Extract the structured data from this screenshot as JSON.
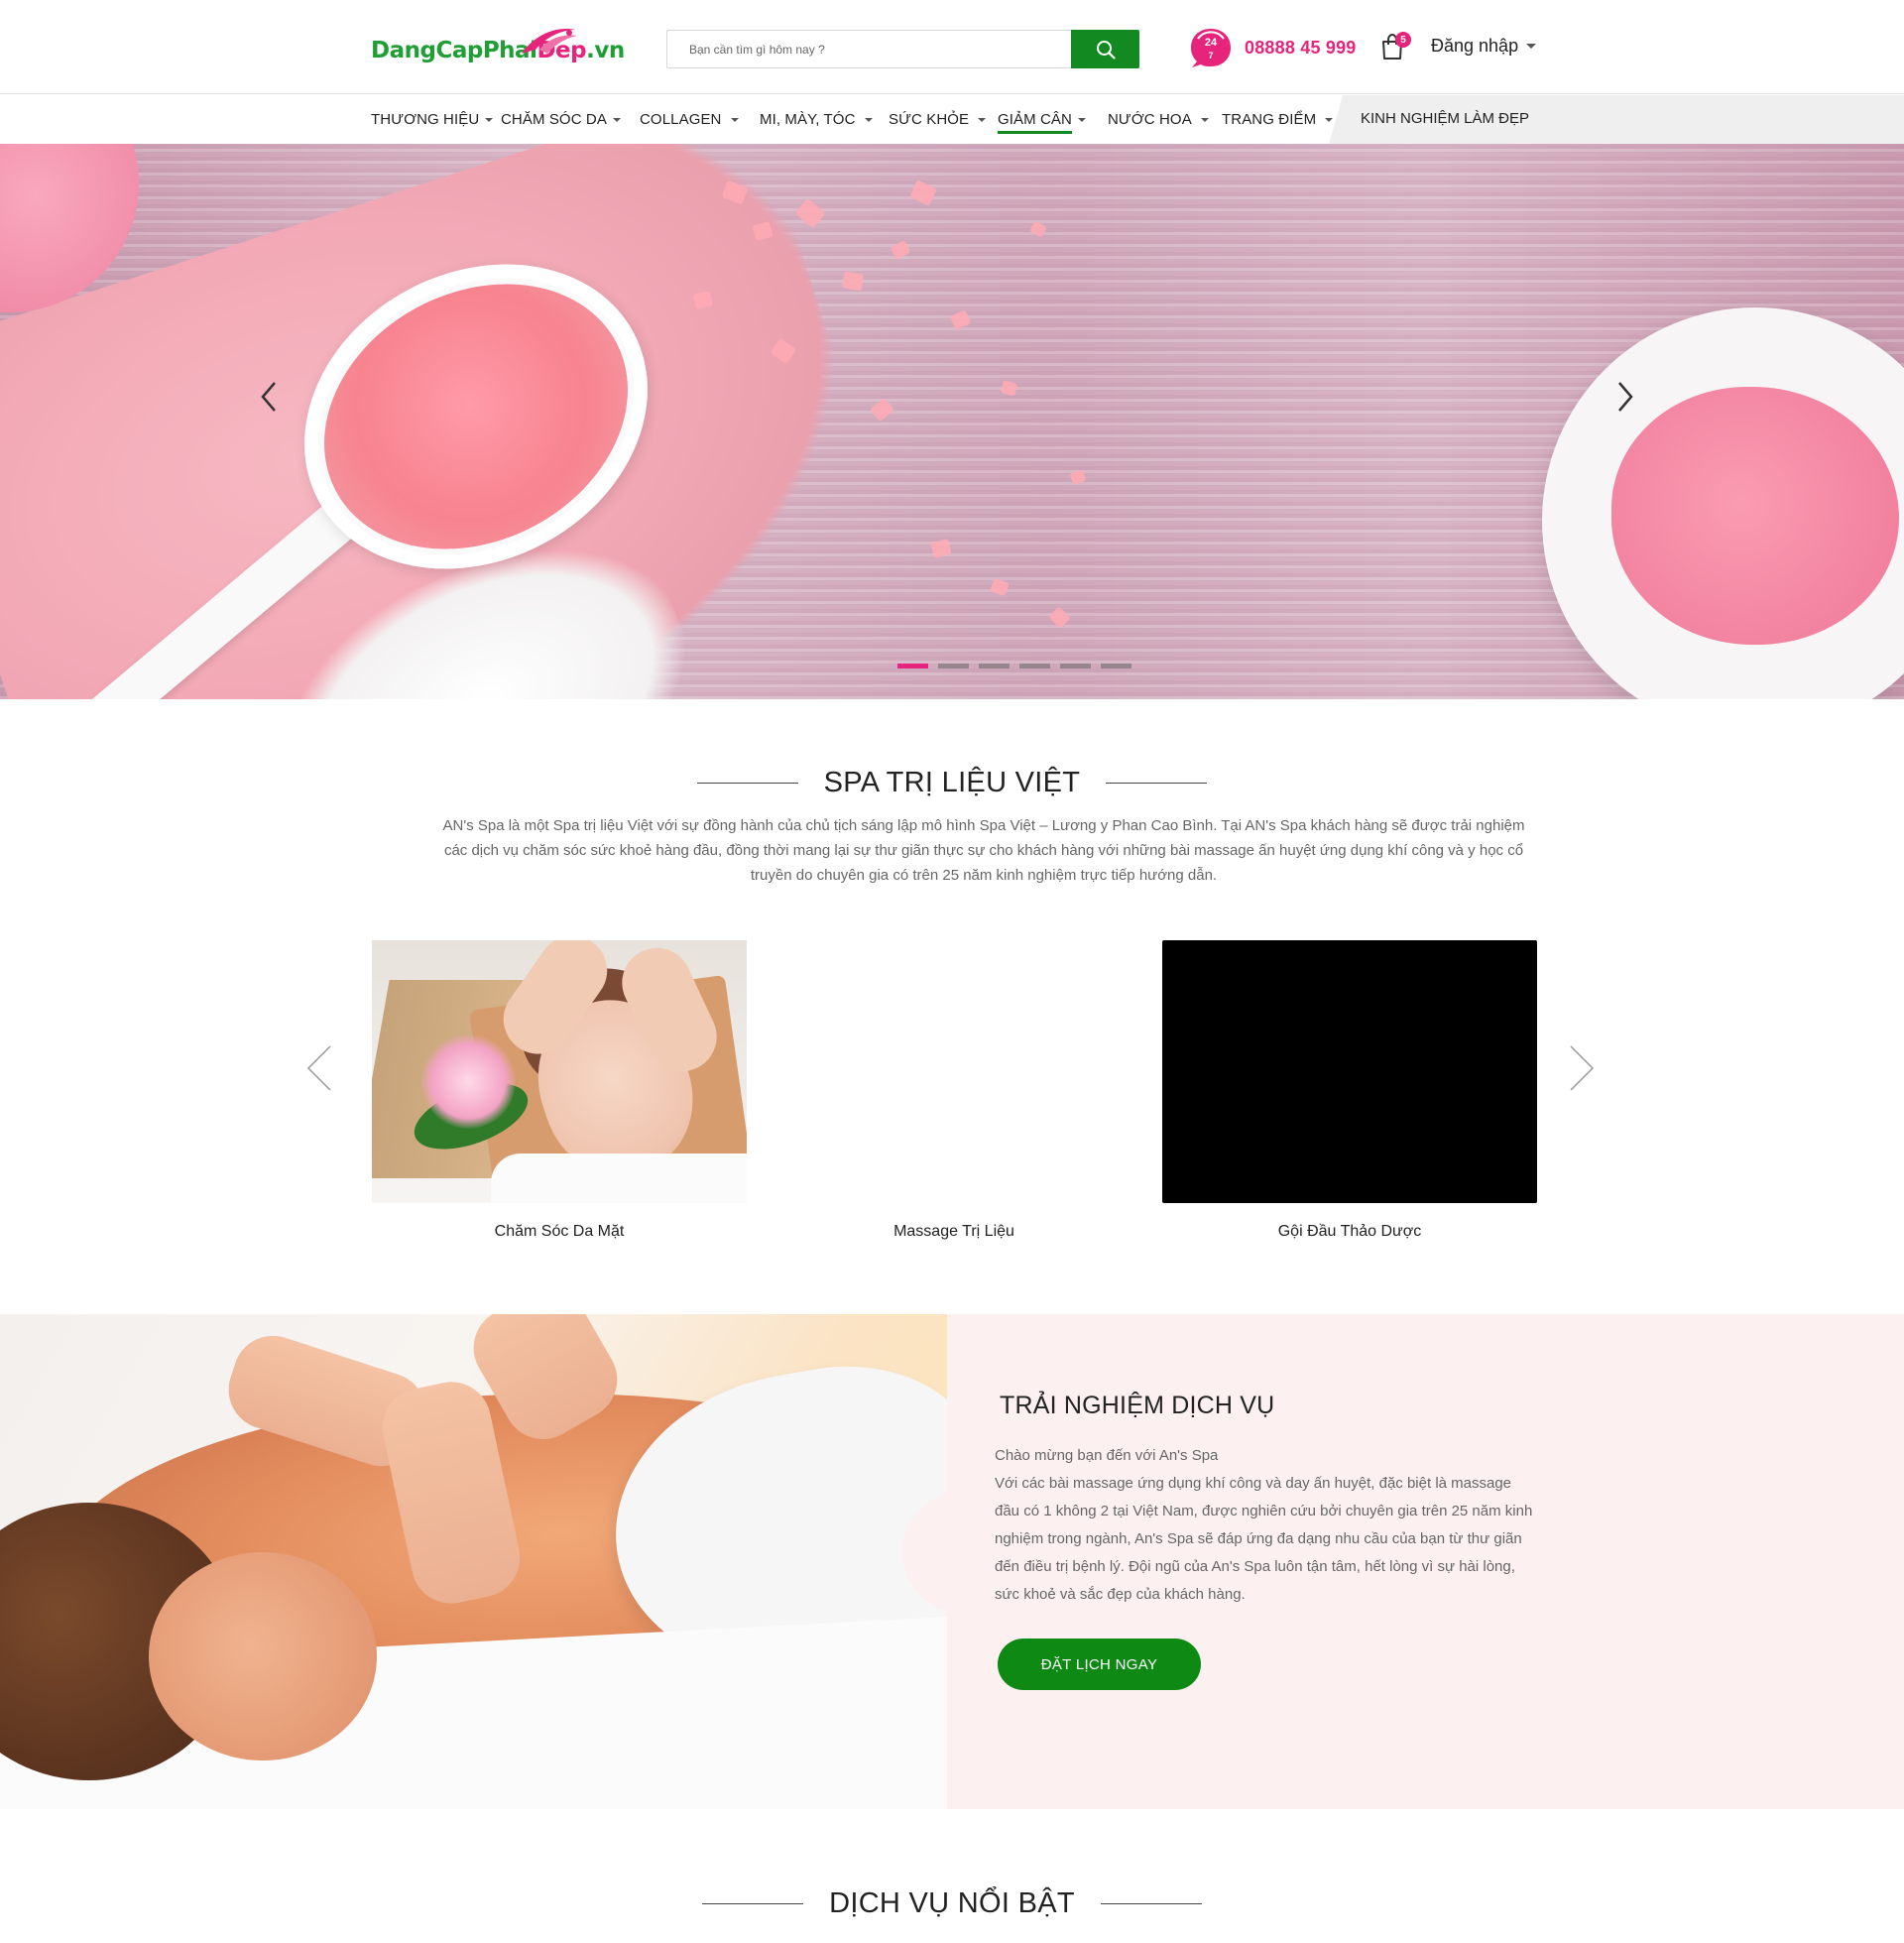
{
  "header": {
    "logo": {
      "text_green": "DangCapPhai",
      "text_pink": "Dep",
      "text_green2": ".vn"
    },
    "search": {
      "placeholder": "Bạn cần tìm gì hôm nay ?"
    },
    "hotline": {
      "badge": "24",
      "number": "08888 45 999"
    },
    "cart": {
      "count": "5"
    },
    "login": {
      "label": "Đăng nhập"
    }
  },
  "nav": {
    "items": [
      {
        "label": "THƯƠNG HIỆU"
      },
      {
        "label": "CHĂM SÓC DA"
      },
      {
        "label": "COLLAGEN"
      },
      {
        "label": "MI, MÀY, TÓC"
      },
      {
        "label": "SỨC KHỎE"
      },
      {
        "label": "GIẢM CÂN"
      },
      {
        "label": "NƯỚC HOA"
      },
      {
        "label": "TRANG ĐIỂM"
      }
    ],
    "special": "KINH NGHIỆM LÀM ĐẸP",
    "active_index": 5
  },
  "hero": {
    "slide_count": 6,
    "active_slide": 0,
    "colors": {
      "dot_active": "#e6247c",
      "dot_inactive": "#8d7f86"
    }
  },
  "spa": {
    "title": "SPA TRỊ LIỆU VIỆT",
    "intro": "AN's Spa là một Spa trị liệu Việt với sự đồng hành của chủ tịch sáng lập mô hình Spa Việt – Lương y Phan Cao Bình. Tại AN's Spa khách hàng sẽ được trải nghiệm các dịch vụ chăm sóc sức khoẻ hàng đầu, đồng thời mang lại sự thư giãn thực sự cho khách hàng với những bài massage ấn huyệt ứng dụng khí công và y học cổ truyền do chuyên gia có trên 25 năm kinh nghiệm trực tiếp hướng dẫn.",
    "services": [
      {
        "name": "Chăm Sóc Da Mặt"
      },
      {
        "name": "Massage Trị Liệu"
      },
      {
        "name": "Gội Đầu Thảo Dược"
      }
    ]
  },
  "experience": {
    "title": "TRẢI NGHIỆM DỊCH VỤ",
    "greeting": "Chào mừng bạn đến với An's Spa",
    "body": "Với các bài massage ứng dụng khí công và day ấn huyệt, đặc biệt là massage đầu có 1 không 2 tại Việt Nam, được nghiên cứu bởi chuyên gia trên 25 năm kinh nghiệm trong ngành, An's Spa sẽ đáp ứng đa dạng nhu cầu của bạn từ thư giãn đến điều trị bệnh lý. Đội ngũ của An's Spa luôn tận tâm, hết lòng vì sự hài lòng, sức khoẻ và sắc đẹp của khách hàng.",
    "button": "ĐẶT LỊCH NGAY"
  },
  "featured": {
    "title": "DỊCH VỤ NỔI BẬT"
  },
  "colors": {
    "brand_green": "#128a21",
    "brand_pink": "#e6247c",
    "button_green": "#0e8a14",
    "panel_pink": "#fdf0f0"
  },
  "icons": [
    "search-icon",
    "hotline-24-7-icon",
    "cart-icon",
    "chevron-left-icon",
    "chevron-right-icon"
  ]
}
